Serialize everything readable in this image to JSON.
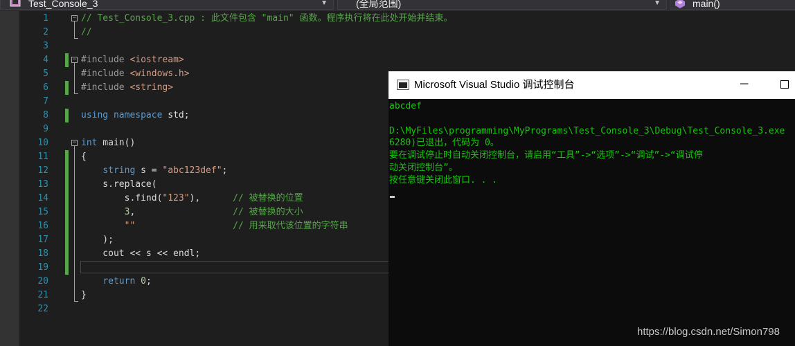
{
  "navbar": {
    "project": "Test_Console_3",
    "scope": "(全局范围)",
    "member": "main()"
  },
  "editor": {
    "line_numbers": [
      "1",
      "2",
      "3",
      "4",
      "5",
      "6",
      "7",
      "8",
      "9",
      "10",
      "11",
      "12",
      "13",
      "14",
      "15",
      "16",
      "17",
      "18",
      "19",
      "20",
      "21",
      "22"
    ],
    "lines": [
      "// Test_Console_3.cpp : 此文件包含 \"main\" 函数。程序执行将在此处开始并结束。",
      "//",
      "",
      "#include <iostream>",
      "#include <windows.h>",
      "#include <string>",
      "",
      "using namespace std;",
      "",
      "int main()",
      "{",
      "    string s = \"abc123def\";",
      "    s.replace(",
      "        s.find(\"123\"),      // 被替换的位置",
      "        3,                  // 被替换的大小",
      "        \"\"                  // 用来取代该位置的字符串",
      "    );",
      "    cout << s << endl;",
      "",
      "    return 0;",
      "}",
      ""
    ]
  },
  "console": {
    "title": "Microsoft Visual Studio 调试控制台",
    "minimize": "─",
    "output": [
      "abcdef",
      "",
      "D:\\MyFiles\\programming\\MyPrograms\\Test_Console_3\\Debug\\Test_Console_3.exe",
      "6280)已退出，代码为 0。",
      "要在调试停止时自动关闭控制台，请启用“工具”->“选项”->“调试”->“调试停",
      "动关闭控制台”。",
      "按任意键关闭此窗口. . ."
    ]
  },
  "watermark": "https://blog.csdn.net/Simon798",
  "colors": {
    "background": "#1e1e1e",
    "line_number": "#2b91af",
    "comment": "#57a64a",
    "keyword": "#569cd6",
    "string": "#d69d85",
    "console_text": "#16c60c"
  }
}
